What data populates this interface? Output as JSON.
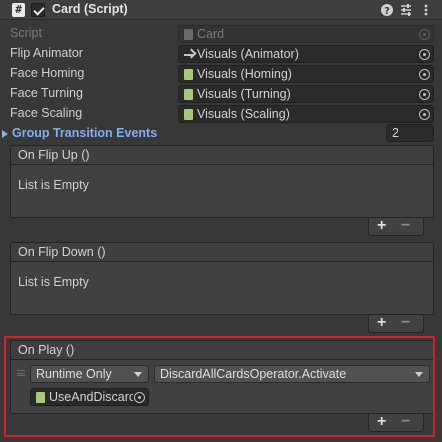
{
  "header": {
    "title": "Card (Script)",
    "enabled": true,
    "icons": [
      "script-icon",
      "help-icon",
      "presets-icon",
      "menu-icon"
    ]
  },
  "properties": [
    {
      "label": "Script",
      "value": "Card",
      "icon": "script-asset-icon",
      "disabled": true
    },
    {
      "label": "Flip Animator",
      "value": "Visuals (Animator)",
      "icon": "animator-icon",
      "disabled": false
    },
    {
      "label": "Face Homing",
      "value": "Visuals (Homing)",
      "icon": "component-icon",
      "disabled": false
    },
    {
      "label": "Face Turning",
      "value": "Visuals (Turning)",
      "icon": "component-icon",
      "disabled": false
    },
    {
      "label": "Face Scaling",
      "value": "Visuals (Scaling)",
      "icon": "component-icon",
      "disabled": false
    }
  ],
  "group_transition": {
    "label": "Group Transition Events",
    "size": "2"
  },
  "events": [
    {
      "title": "On Flip Up ()",
      "empty_text": "List is Empty"
    },
    {
      "title": "On Flip Down ()",
      "empty_text": "List is Empty"
    },
    {
      "title": "On Play ()",
      "entry": {
        "runtime_mode": "Runtime Only",
        "function": "DiscardAllCardsOperator.Activate",
        "target": "UseAndDiscarc"
      }
    }
  ],
  "list_buttons": {
    "add": "+",
    "remove": "−"
  },
  "colors": {
    "highlight": "#d51d2b",
    "foldout_label": "#7fb0ec"
  }
}
